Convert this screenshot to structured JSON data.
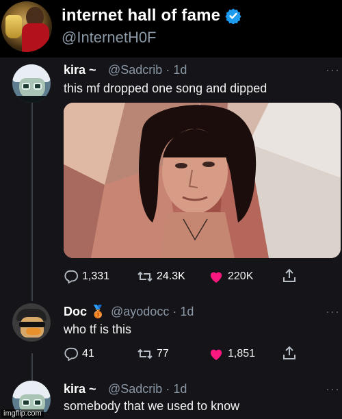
{
  "header": {
    "display_name": "internet hall of fame",
    "handle": "@InternetH0F",
    "verified_icon": "verified-badge-icon",
    "accent_color": "#1d9bf0"
  },
  "tweets": [
    {
      "author": "kira ~",
      "handle": "@Sadcrib",
      "time": "· 1d",
      "text": "this mf dropped one song and dipped",
      "stats": {
        "replies": "1,331",
        "retweets": "24.3K",
        "likes": "220K"
      }
    },
    {
      "author": "Doc",
      "badge": "🥉",
      "handle": "@ayodocc",
      "time": "· 1d",
      "text": "who tf is this",
      "stats": {
        "replies": "41",
        "retweets": "77",
        "likes": "1,851"
      }
    },
    {
      "author": "kira ~",
      "handle": "@Sadcrib",
      "time": "· 1d",
      "text": "somebody that we used to know"
    }
  ],
  "more_label": "···",
  "watermark": "imgflip.com",
  "colors": {
    "like": "#f91880",
    "muted": "#8b98a5",
    "card_bg": "#141419"
  }
}
